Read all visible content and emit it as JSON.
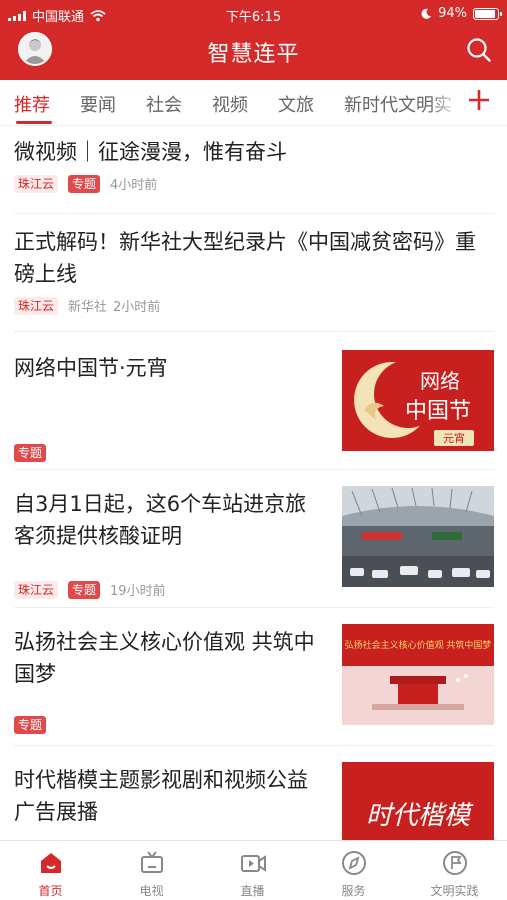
{
  "status_bar": {
    "carrier": "中国联通",
    "time": "下午6:15",
    "battery": "94%",
    "battery_level": 0.94
  },
  "header": {
    "title": "智慧连平",
    "avatar_icon": "user-avatar",
    "search_icon": "search-icon",
    "brand_color": "#d42a2a"
  },
  "tabs": [
    {
      "label": "推荐",
      "active": true
    },
    {
      "label": "要闻"
    },
    {
      "label": "社会"
    },
    {
      "label": "视频"
    },
    {
      "label": "文旅"
    },
    {
      "label": "新时代文明实"
    }
  ],
  "add_tab_icon": "plus-icon",
  "feed": [
    {
      "title": "微视频｜征途漫漫，惟有奋斗",
      "tags": [
        "珠江云",
        "专题"
      ],
      "meta": "4小时前"
    },
    {
      "title": "正式解码！新华社大型纪录片《中国减贫密码》重磅上线",
      "tags": [
        "珠江云"
      ],
      "source": "新华社",
      "meta": "2小时前"
    },
    {
      "title": "网络中国节·元宵",
      "tags": [
        "专题"
      ],
      "thumb_text": [
        "网络",
        "中国节",
        "元宵"
      ]
    },
    {
      "title": "自3月1日起，这6个车站进京旅客须提供核酸证明",
      "tags": [
        "珠江云",
        "专题"
      ],
      "meta": "19小时前"
    },
    {
      "title": "弘扬社会主义核心价值观 共筑中国梦",
      "tags": [
        "专题"
      ],
      "thumb_text": [
        "弘扬社会主义核心价值观 共筑中国梦"
      ]
    },
    {
      "title": "时代楷模主题影视剧和视频公益广告展播",
      "thumb_text": [
        "时代楷模"
      ]
    }
  ],
  "bottom_nav": [
    {
      "label": "首页",
      "icon": "home-icon",
      "active": true
    },
    {
      "label": "电视",
      "icon": "tv-icon"
    },
    {
      "label": "直播",
      "icon": "live-video-icon"
    },
    {
      "label": "服务",
      "icon": "compass-icon"
    },
    {
      "label": "文明实践",
      "icon": "flag-circle-icon"
    }
  ]
}
